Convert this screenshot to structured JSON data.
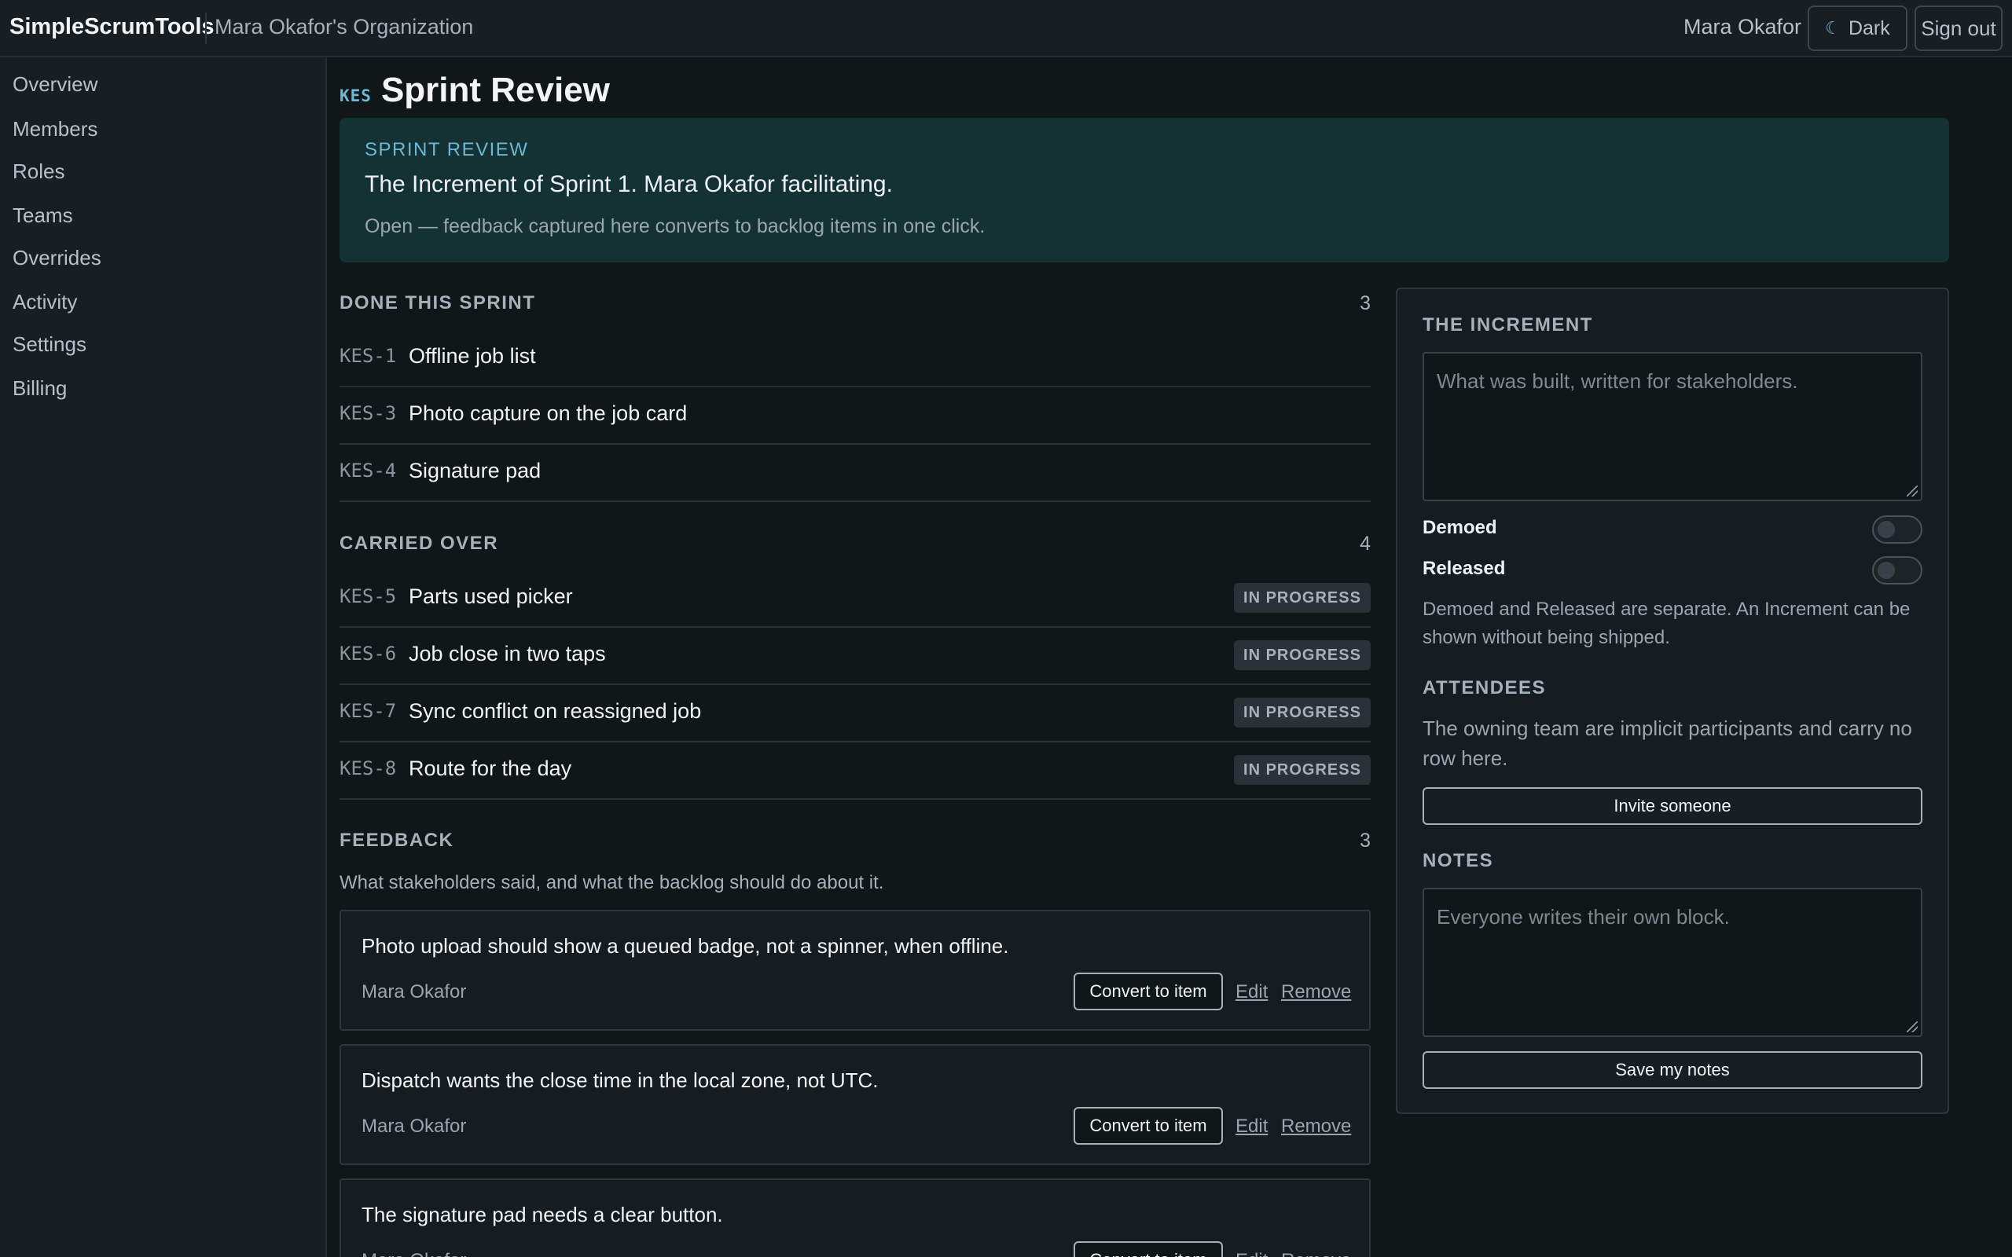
{
  "app": {
    "brand": "SimpleScrumTools",
    "org": "Mara Okafor's Organization",
    "user": "Mara Okafor",
    "theme_label": "Dark",
    "signout_label": "Sign out"
  },
  "sidebar": {
    "items": [
      {
        "label": "Overview"
      },
      {
        "label": "Members"
      },
      {
        "label": "Roles"
      },
      {
        "label": "Teams"
      },
      {
        "label": "Overrides"
      },
      {
        "label": "Activity"
      },
      {
        "label": "Settings"
      },
      {
        "label": "Billing"
      }
    ]
  },
  "page": {
    "project_key": "KES",
    "title": "Sprint Review"
  },
  "banner": {
    "eyebrow": "SPRINT REVIEW",
    "text": "The Increment of Sprint 1. Mara Okafor facilitating.",
    "sub": "Open — feedback captured here converts to backlog items in one click."
  },
  "done": {
    "heading": "DONE THIS SPRINT",
    "count": "3",
    "items": [
      {
        "key": "KES-1",
        "title": "Offline job list"
      },
      {
        "key": "KES-3",
        "title": "Photo capture on the job card"
      },
      {
        "key": "KES-4",
        "title": "Signature pad"
      }
    ]
  },
  "carried": {
    "heading": "CARRIED OVER",
    "count": "4",
    "items": [
      {
        "key": "KES-5",
        "title": "Parts used picker",
        "status": "IN PROGRESS"
      },
      {
        "key": "KES-6",
        "title": "Job close in two taps",
        "status": "IN PROGRESS"
      },
      {
        "key": "KES-7",
        "title": "Sync conflict on reassigned job",
        "status": "IN PROGRESS"
      },
      {
        "key": "KES-8",
        "title": "Route for the day",
        "status": "IN PROGRESS"
      }
    ]
  },
  "feedback": {
    "heading": "FEEDBACK",
    "count": "3",
    "description": "What stakeholders said, and what the backlog should do about it.",
    "convert_label": "Convert to item",
    "edit_label": "Edit",
    "remove_label": "Remove",
    "items": [
      {
        "text": "Photo upload should show a queued badge, not a spinner, when offline.",
        "author": "Mara Okafor"
      },
      {
        "text": "Dispatch wants the close time in the local zone, not UTC.",
        "author": "Mara Okafor"
      },
      {
        "text": "The signature pad needs a clear button.",
        "author": "Mara Okafor"
      }
    ]
  },
  "increment": {
    "heading": "THE INCREMENT",
    "placeholder": "What was built, written for stakeholders.",
    "demoed_label": "Demoed",
    "demoed": false,
    "released_label": "Released",
    "released": false,
    "note": "Demoed and Released are separate. An Increment can be shown without being shipped."
  },
  "attendees": {
    "heading": "ATTENDEES",
    "note": "The owning team are implicit participants and carry no row here.",
    "invite_label": "Invite someone"
  },
  "notes": {
    "heading": "NOTES",
    "placeholder": "Everyone writes their own block.",
    "save_label": "Save my notes"
  }
}
